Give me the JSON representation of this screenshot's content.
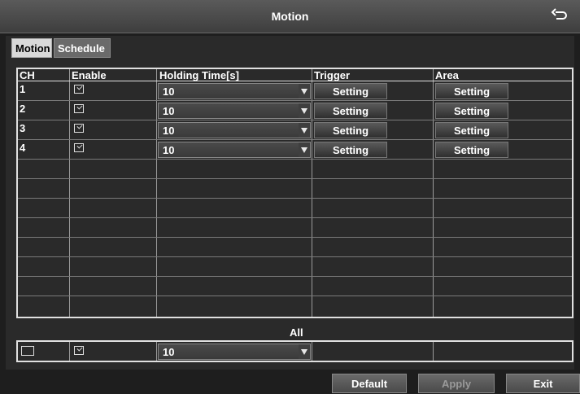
{
  "header": {
    "title": "Motion",
    "back_icon": "return-arrow-icon"
  },
  "tabs": [
    {
      "label": "Motion",
      "active": true
    },
    {
      "label": "Schedule",
      "active": false
    }
  ],
  "table": {
    "columns": [
      "CH",
      "Enable",
      "Holding Time[s]",
      "Trigger",
      "Area"
    ],
    "rows": [
      {
        "ch": "1",
        "enable": true,
        "holding_time": "10",
        "trigger": "Setting",
        "area": "Setting"
      },
      {
        "ch": "2",
        "enable": true,
        "holding_time": "10",
        "trigger": "Setting",
        "area": "Setting"
      },
      {
        "ch": "3",
        "enable": true,
        "holding_time": "10",
        "trigger": "Setting",
        "area": "Setting"
      },
      {
        "ch": "4",
        "enable": true,
        "holding_time": "10",
        "trigger": "Setting",
        "area": "Setting"
      }
    ]
  },
  "all": {
    "label": "All",
    "select_all": false,
    "enable": true,
    "holding_time": "10"
  },
  "footer": {
    "default_label": "Default",
    "apply_label": "Apply",
    "exit_label": "Exit"
  }
}
